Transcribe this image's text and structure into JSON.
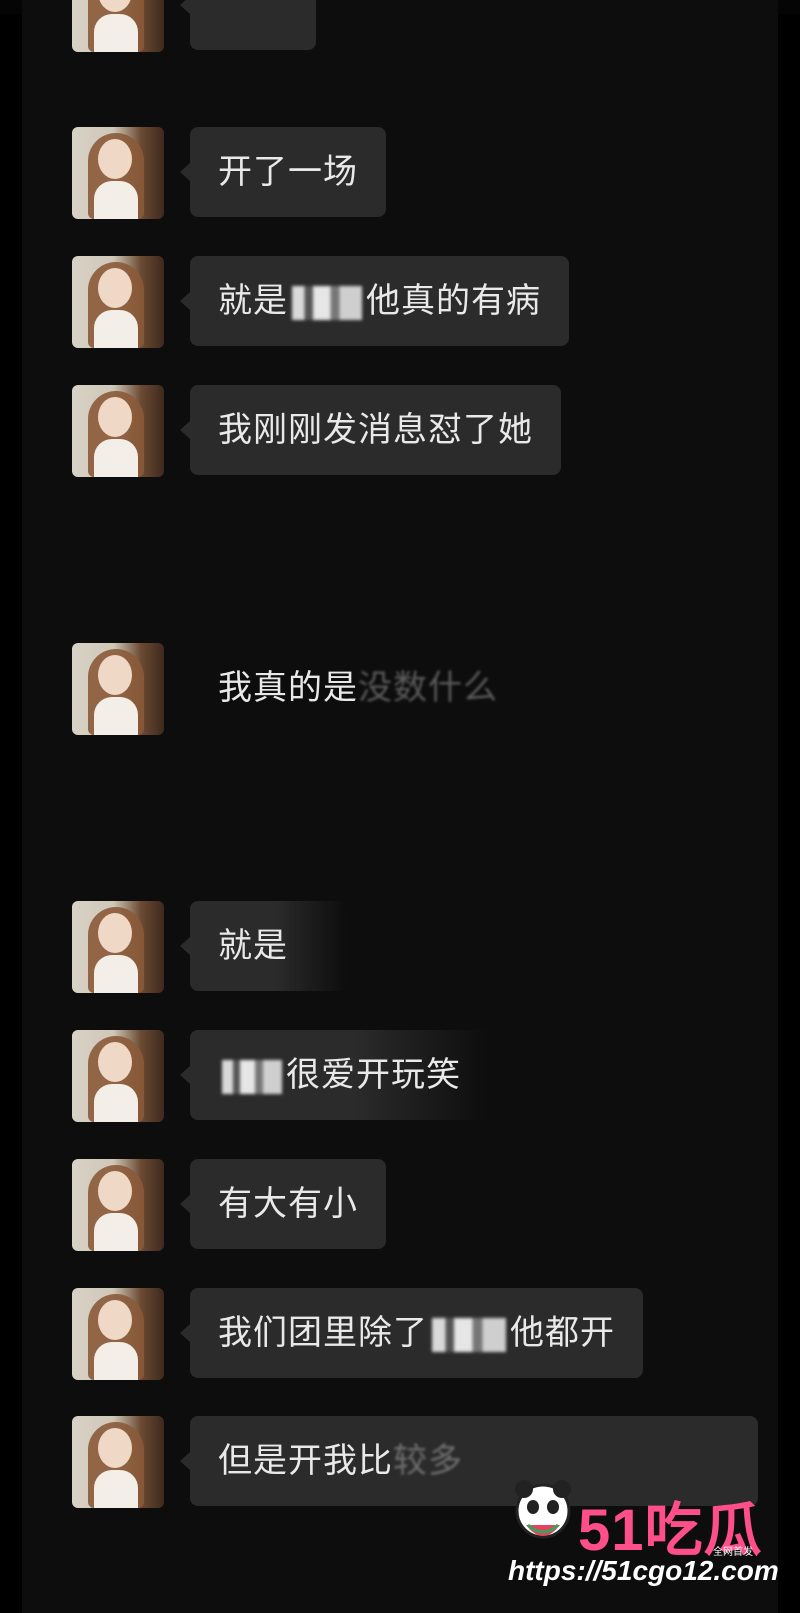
{
  "messages": [
    {
      "text": "开了一场"
    },
    {
      "pre": "就是",
      "post": "他真的有病"
    },
    {
      "text": "我刚刚发消息怼了她"
    },
    {
      "pre": "我真的是",
      "post": "没数什么"
    },
    {
      "text": "就是"
    },
    {
      "pre": "",
      "post": "很爱开玩笑"
    },
    {
      "text": "有大有小"
    },
    {
      "pre": "我们团里除了",
      "post": "他都开"
    },
    {
      "pre": "但是开我比",
      "post": "较多"
    }
  ],
  "watermark": {
    "brand": "51吃瓜",
    "tagline": "全网首发",
    "url": "https://51cgo12.com"
  }
}
